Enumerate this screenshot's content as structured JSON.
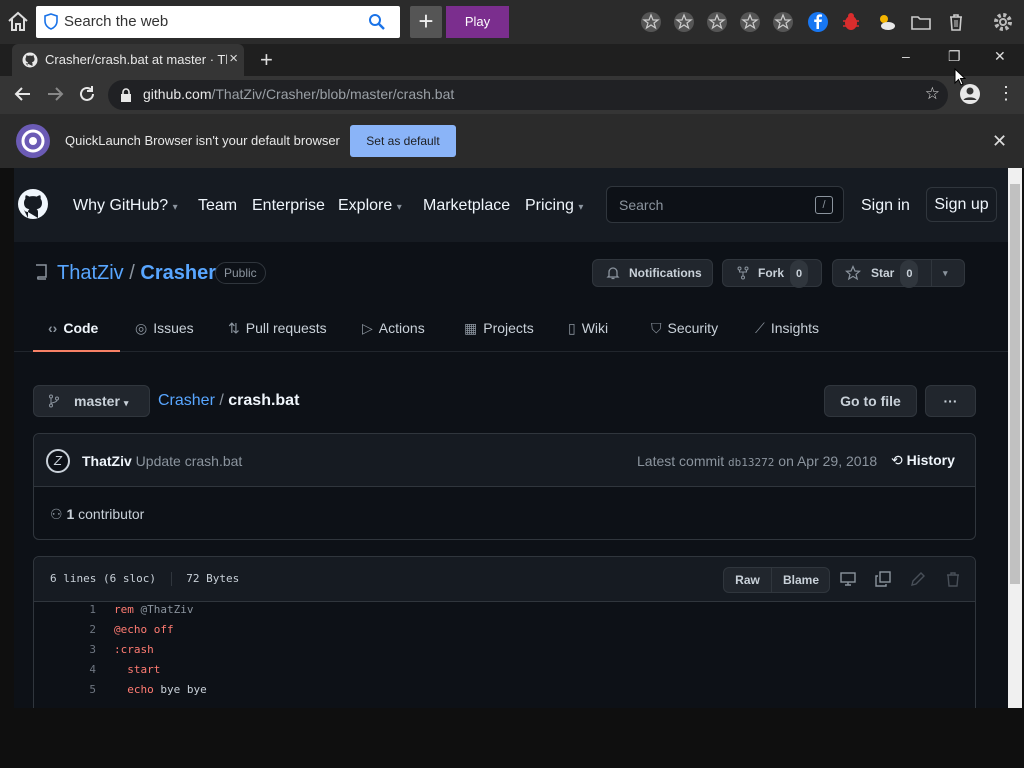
{
  "toolbar": {
    "search_placeholder": "Search the web",
    "play_label": "Play"
  },
  "tab": {
    "title": "Crasher/crash.bat at master · ThatZiv/Crasher",
    "close": "×",
    "new_tab": "+"
  },
  "window": {
    "minimize": "–",
    "restore": "❐",
    "close": "✕"
  },
  "address": {
    "host": "github.com",
    "path": "/ThatZiv/Crasher/blob/master/crash.bat"
  },
  "infobar": {
    "message": "QuickLaunch Browser isn't your default browser",
    "button": "Set as default",
    "close": "✕"
  },
  "github": {
    "nav": [
      "Why GitHub?",
      "Team",
      "Enterprise",
      "Explore",
      "Marketplace",
      "Pricing"
    ],
    "search_placeholder": "Search",
    "search_key": "/",
    "sign_in": "Sign in",
    "sign_up": "Sign up"
  },
  "repo": {
    "owner": "ThatZiv",
    "separator": "/",
    "name": "Crasher",
    "visibility": "Public",
    "notifications": "Notifications",
    "fork_label": "Fork",
    "fork_count": "0",
    "star_label": "Star",
    "star_count": "0",
    "tabs": [
      "Code",
      "Issues",
      "Pull requests",
      "Actions",
      "Projects",
      "Wiki",
      "Security",
      "Insights"
    ]
  },
  "file": {
    "branch": "master",
    "repo_link": "Crasher",
    "sep": "/",
    "filename": "crash.bat",
    "go_to_file": "Go to file",
    "more": "···",
    "commit_author": "ThatZiv",
    "commit_message": "Update crash.bat",
    "latest_commit_label": "Latest commit",
    "commit_hash": "db13272",
    "commit_date": "on Apr 29, 2018",
    "history": "History",
    "contributors_count": "1",
    "contributors_label": "contributor",
    "lines_info": "6 lines (6 sloc)",
    "size": "72 Bytes",
    "raw": "Raw",
    "blame": "Blame"
  },
  "code": [
    {
      "n": "1",
      "kw": "rem",
      "rest": " @ThatZiv",
      "indent": ""
    },
    {
      "n": "2",
      "kw": "@echo off",
      "rest": "",
      "indent": ""
    },
    {
      "n": "3",
      "kw": ":crash",
      "rest": "",
      "indent": ""
    },
    {
      "n": "4",
      "kw": "start",
      "rest": "",
      "indent": "  "
    },
    {
      "n": "5",
      "kw": "echo",
      "rest": " bye bye",
      "indent": "  "
    }
  ],
  "colors": {
    "accent_link": "#58a6ff",
    "play": "#7b2e8e",
    "tab_underline": "#f78166"
  }
}
